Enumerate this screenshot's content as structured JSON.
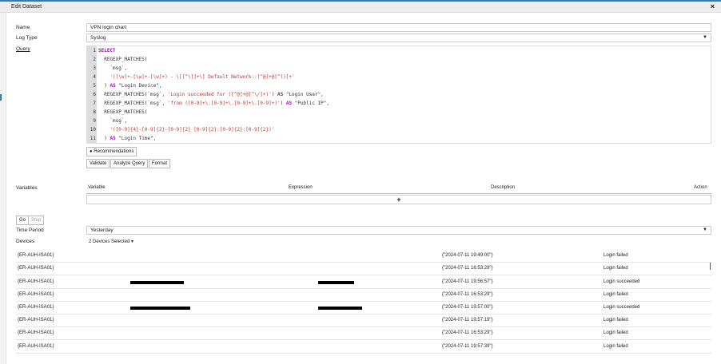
{
  "dialog": {
    "title": "Edit Dataset",
    "close_icon": "×"
  },
  "form": {
    "name_label": "Name",
    "name_value": "VPN login chart",
    "logtype_label": "Log Type",
    "logtype_value": "Syslog",
    "query_label": "Query"
  },
  "query_lines": [
    {
      "n": "1",
      "parts": [
        [
          "kw",
          "SELECT"
        ]
      ]
    },
    {
      "n": "2",
      "parts": [
        [
          "id",
          "  REGEXP_MATCHES("
        ]
      ]
    },
    {
      "n": "3",
      "parts": [
        [
          "id",
          "    `msg`,"
        ]
      ]
    },
    {
      "n": "4",
      "parts": [
        [
          "str",
          "    '([\\w]+-[\\w]+-[\\w]+) - \\[[^\\]]+\\] Default Network::[^@]+@[^()]+'"
        ]
      ]
    },
    {
      "n": "5",
      "parts": [
        [
          "id",
          "  ) "
        ],
        [
          "kw",
          "AS"
        ],
        [
          "id",
          " \"Login Device\","
        ]
      ]
    },
    {
      "n": "6",
      "parts": [
        [
          "id",
          "  REGEXP_MATCHES(`msg`, "
        ],
        [
          "str",
          "'Login succeeded for ([^@]+@[^\\/]+)'"
        ],
        [
          "id",
          ") "
        ],
        [
          "kw",
          "AS"
        ],
        [
          "id",
          " \"Login User\","
        ]
      ]
    },
    {
      "n": "7",
      "parts": [
        [
          "id",
          "  REGEXP_MATCHES(`msg`, "
        ],
        [
          "str",
          "'from ([0-9]+\\.[0-9]+\\.[0-9]+\\.[0-9]+)'"
        ],
        [
          "id",
          ") "
        ],
        [
          "kw",
          "AS"
        ],
        [
          "id",
          " \"Public IP\","
        ]
      ]
    },
    {
      "n": "8",
      "parts": [
        [
          "id",
          "  REGEXP_MATCHES("
        ]
      ]
    },
    {
      "n": "9",
      "parts": [
        [
          "id",
          "    `msg`,"
        ]
      ]
    },
    {
      "n": "10",
      "parts": [
        [
          "str",
          "    '([0-9]{4}-[0-9]{2}-[0-9]{2} [0-9]{2}:[0-9]{2}:[0-9]{2})'"
        ]
      ]
    },
    {
      "n": "11",
      "parts": [
        [
          "id",
          "  ) "
        ],
        [
          "kw",
          "AS"
        ],
        [
          "id",
          " \"Login Time\","
        ]
      ]
    }
  ],
  "buttons": {
    "recommendations": "Recommendations",
    "validate": "Validate",
    "analyze": "Analyze Query",
    "format": "Format",
    "go": "Go",
    "stop": "Stop",
    "add": "+"
  },
  "variables": {
    "label": "Variables",
    "headers": [
      "Variable",
      "Expression",
      "Description",
      "Action"
    ]
  },
  "time_period": {
    "label": "Time Period",
    "value": "Yesterday"
  },
  "devices": {
    "label": "Devices",
    "value": "2 Devices Selected ▾"
  },
  "rows": [
    {
      "device": "{ER-AUH-ISA01}",
      "time": "{\"2024-07-11 19:49:00\"}",
      "status": "Login failed",
      "redacted": false
    },
    {
      "device": "{ER-AUH-ISA01}",
      "time": "{\"2024-07-11 16:53:29\"}",
      "status": "Login failed",
      "redacted": false
    },
    {
      "device": "{ER-AUH-ISA01}",
      "time": "{\"2024-07-11 19:56:57\"}",
      "status": "Login succeeded",
      "redacted": true
    },
    {
      "device": "{ER-AUH-ISA01}",
      "time": "{\"2024-07-11 16:53:29\"}",
      "status": "Login failed",
      "redacted": false
    },
    {
      "device": "{ER-AUH-ISA01}",
      "time": "{\"2024-07-11 19:57:00\"}",
      "status": "Login succeeded",
      "redacted": true
    },
    {
      "device": "{ER-AUH-ISA01}",
      "time": "{\"2024-07-11 19:57:19\"}",
      "status": "Login failed",
      "redacted": false
    },
    {
      "device": "{ER-AUH-ISA01}",
      "time": "{\"2024-07-11 16:53:29\"}",
      "status": "Login failed",
      "redacted": false
    },
    {
      "device": "{ER-AUH-ISA01}",
      "time": "{\"2024-07-11 19:57:39\"}",
      "status": "Login failed",
      "redacted": false
    }
  ]
}
